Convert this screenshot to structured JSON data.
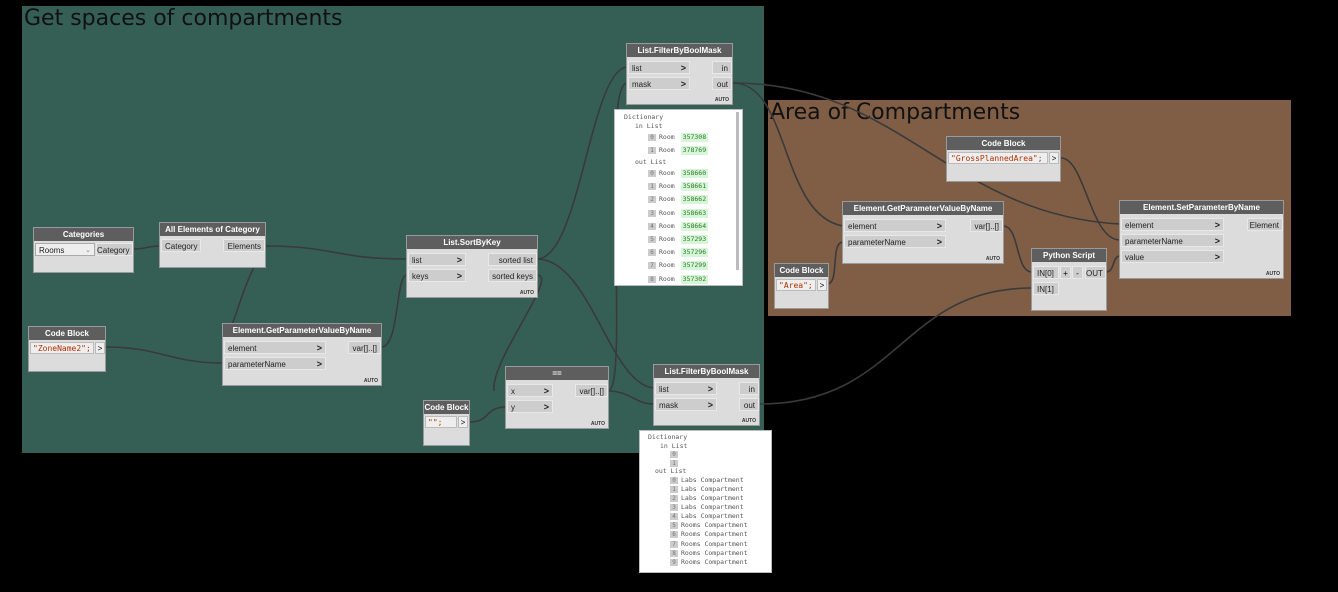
{
  "groups": {
    "g1_title": "Get spaces of compartments",
    "g2_title": "Area of Compartments",
    "g1_color": "#355f55",
    "g2_color": "#7f5e45"
  },
  "nodes": {
    "categories": {
      "title": "Categories",
      "selected": "Rooms",
      "out": "Category"
    },
    "all_elements": {
      "title": "All Elements of Category",
      "in": "Category",
      "out": "Elements"
    },
    "code_zone": {
      "title": "Code Block",
      "code": "\"ZoneName2\";",
      "out": ">"
    },
    "get_param1": {
      "title": "Element.GetParameterValueByName",
      "in1": "element",
      "in2": "parameterName",
      "out": "var[]..[]",
      "lacing": "AUTO"
    },
    "sortbykey": {
      "title": "List.SortByKey",
      "in1": "list",
      "in2": "keys",
      "out1": "sorted list",
      "out2": "sorted keys",
      "lacing": "AUTO"
    },
    "code_empty": {
      "title": "Code Block",
      "code": "\"\";",
      "out": ">"
    },
    "equals": {
      "title": "==",
      "in1": "x",
      "in2": "y",
      "out": "var[]..[]",
      "lacing": "AUTO"
    },
    "filter_top": {
      "title": "List.FilterByBoolMask",
      "in1": "list",
      "in2": "mask",
      "out1": "in",
      "out2": "out",
      "lacing": "AUTO"
    },
    "filter_bottom": {
      "title": "List.FilterByBoolMask",
      "in1": "list",
      "in2": "mask",
      "out1": "in",
      "out2": "out",
      "lacing": "AUTO"
    },
    "code_gross": {
      "title": "Code Block",
      "code": "\"GrossPlannedArea\";",
      "out": ">"
    },
    "get_param2": {
      "title": "Element.GetParameterValueByName",
      "in1": "element",
      "in2": "parameterName",
      "out": "var[]..[]",
      "lacing": "AUTO"
    },
    "code_area": {
      "title": "Code Block",
      "code": "\"Area\";",
      "out": ">"
    },
    "python": {
      "title": "Python Script",
      "in1": "IN[0]",
      "in2": "IN[1]",
      "plus": "+",
      "minus": "-",
      "out": "OUT"
    },
    "setparam": {
      "title": "Element.SetParameterByName",
      "in1": "element",
      "in2": "parameterName",
      "in3": "value",
      "out": "Element",
      "lacing": "AUTO"
    }
  },
  "preview_top": {
    "header": "Dictionary",
    "in_label": "in List",
    "out_label": "out List",
    "in_items": [
      {
        "i": "0",
        "t": "Room",
        "v": "357308"
      },
      {
        "i": "1",
        "t": "Room",
        "v": "378769"
      }
    ],
    "out_items": [
      {
        "i": "0",
        "t": "Room",
        "v": "358660"
      },
      {
        "i": "1",
        "t": "Room",
        "v": "358661"
      },
      {
        "i": "2",
        "t": "Room",
        "v": "358662"
      },
      {
        "i": "3",
        "t": "Room",
        "v": "358663"
      },
      {
        "i": "4",
        "t": "Room",
        "v": "358664"
      },
      {
        "i": "5",
        "t": "Room",
        "v": "357293"
      },
      {
        "i": "6",
        "t": "Room",
        "v": "357296"
      },
      {
        "i": "7",
        "t": "Room",
        "v": "357299"
      },
      {
        "i": "8",
        "t": "Room",
        "v": "357302"
      }
    ]
  },
  "preview_bottom": {
    "header": "Dictionary",
    "in_label": "in List",
    "out_label": "out List",
    "in_items": [
      {
        "i": "0"
      },
      {
        "i": "1"
      }
    ],
    "out_items": [
      {
        "i": "0",
        "t": "Labs Compartment"
      },
      {
        "i": "1",
        "t": "Labs Compartment"
      },
      {
        "i": "2",
        "t": "Labs Compartment"
      },
      {
        "i": "3",
        "t": "Labs Compartment"
      },
      {
        "i": "4",
        "t": "Labs Compartment"
      },
      {
        "i": "5",
        "t": "Rooms Compartment"
      },
      {
        "i": "6",
        "t": "Rooms Compartment"
      },
      {
        "i": "7",
        "t": "Rooms Compartment"
      },
      {
        "i": "8",
        "t": "Rooms Compartment"
      },
      {
        "i": "9",
        "t": "Rooms Compartment"
      }
    ]
  }
}
